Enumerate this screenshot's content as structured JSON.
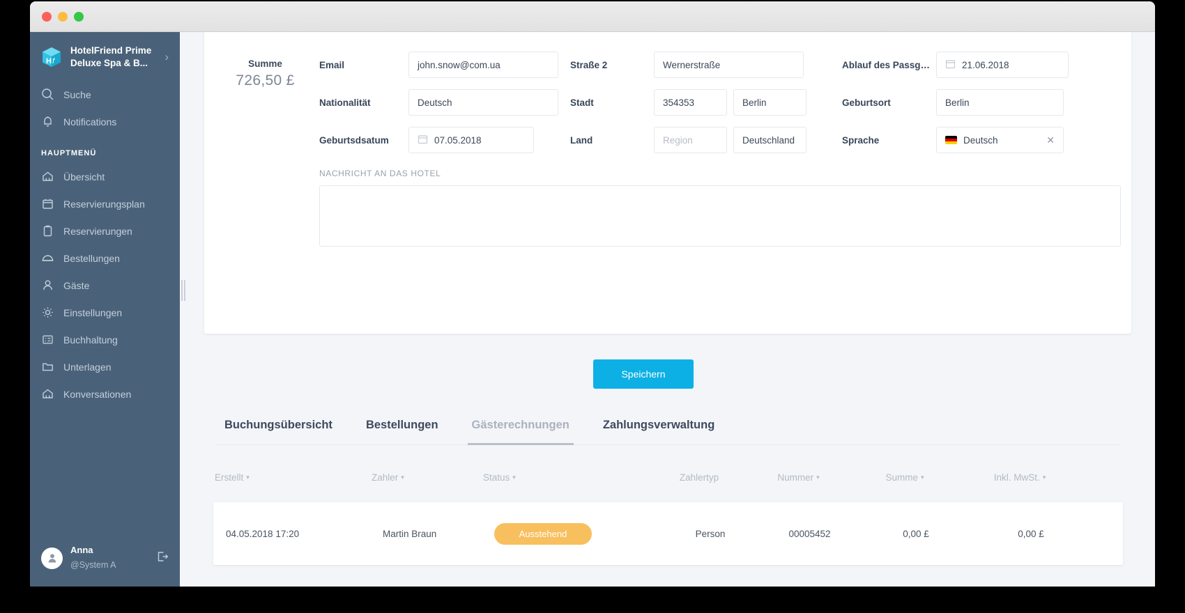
{
  "window": {
    "lights": [
      "close",
      "minimize",
      "maximize"
    ]
  },
  "sidebar": {
    "brand": {
      "line1": "HotelFriend Prime",
      "line2": "Deluxe Spa & B...",
      "chevron": "›"
    },
    "top_items": [
      {
        "label": "Suche",
        "icon": "search-icon"
      },
      {
        "label": "Notifications",
        "icon": "bell-icon"
      }
    ],
    "section_title": "HAUPTMENÜ",
    "items": [
      {
        "label": "Übersicht",
        "icon": "home-icon"
      },
      {
        "label": "Reservierungsplan",
        "icon": "calendar-icon"
      },
      {
        "label": "Reservierungen",
        "icon": "clipboard-icon"
      },
      {
        "label": "Bestellungen",
        "icon": "room-service-icon"
      },
      {
        "label": "Gäste",
        "icon": "user-icon"
      },
      {
        "label": "Einstellungen",
        "icon": "gear-icon"
      },
      {
        "label": "Buchhaltung",
        "icon": "ledger-icon"
      },
      {
        "label": "Unterlagen",
        "icon": "folder-icon"
      },
      {
        "label": "Konversationen",
        "icon": "home-icon"
      }
    ],
    "user": {
      "name": "Anna",
      "handle": "@System A",
      "logout_icon": "logout-icon",
      "avatar_icon": "avatar-icon"
    }
  },
  "form": {
    "summe": {
      "label": "Summe",
      "value": "726,50 £"
    },
    "fields": {
      "email": {
        "label": "Email",
        "value": "john.snow@com.ua"
      },
      "nationalitaet": {
        "label": "Nationalität",
        "value": "Deutsch"
      },
      "geburtsdatum": {
        "label": "Geburtsdsatum",
        "value": "07.05.2018",
        "icon": "calendar-icon"
      },
      "strasse2": {
        "label": "Straße 2",
        "value": "Wernerstraße"
      },
      "stadt": {
        "label": "Stadt",
        "zip": "354353",
        "city": "Berlin"
      },
      "land": {
        "label": "Land",
        "region_placeholder": "Region",
        "country": "Deutschland"
      },
      "passablauf": {
        "label": "Ablauf des Passg…",
        "value": "21.06.2018",
        "icon": "calendar-icon"
      },
      "geburtsort": {
        "label": "Geburtsort",
        "value": "Berlin"
      },
      "sprache": {
        "label": "Sprache",
        "value": "Deutsch",
        "flag": "de-flag-icon",
        "clear": "✕"
      }
    },
    "message": {
      "label": "NACHRICHT AN DAS HOTEL",
      "value": ""
    },
    "save_label": "Speichern"
  },
  "tabs": [
    {
      "label": "Buchungsübersicht",
      "active": false
    },
    {
      "label": "Bestellungen",
      "active": false
    },
    {
      "label": "Gästerechnungen",
      "active": true
    },
    {
      "label": "Zahlungsverwaltung",
      "active": false
    }
  ],
  "table": {
    "columns": [
      {
        "label": "Erstellt",
        "sortable": true
      },
      {
        "label": "Zahler",
        "sortable": true
      },
      {
        "label": "Status",
        "sortable": true
      },
      {
        "label": "Zahlertyp",
        "sortable": false
      },
      {
        "label": "Nummer",
        "sortable": true
      },
      {
        "label": "Summe",
        "sortable": true
      },
      {
        "label": "Inkl. MwSt.",
        "sortable": true
      }
    ],
    "rows": [
      {
        "erstellt": "04.05.2018 17:20",
        "zahler": "Martin Braun",
        "status": "Ausstehend",
        "zahlertyp": "Person",
        "nummer": "00005452",
        "summe": "0,00 £",
        "inkl_mwst": "0,00 £"
      }
    ]
  },
  "colors": {
    "sidebar_bg": "#4a6279",
    "accent_blue": "#0cb0e4",
    "status_pending": "#f8bf5e",
    "content_bg": "#f4f5f9"
  }
}
